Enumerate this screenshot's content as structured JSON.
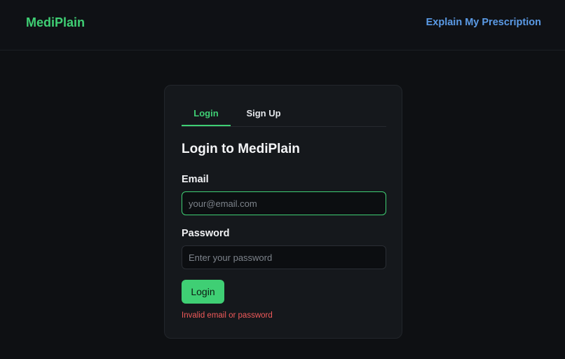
{
  "header": {
    "brand": "MediPlain",
    "nav_link": "Explain My Prescription"
  },
  "auth": {
    "tabs": [
      {
        "label": "Login",
        "active": true
      },
      {
        "label": "Sign Up",
        "active": false
      }
    ],
    "title": "Login to MediPlain",
    "email": {
      "label": "Email",
      "placeholder": "your@email.com",
      "value": ""
    },
    "password": {
      "label": "Password",
      "placeholder": "Enter your password",
      "value": ""
    },
    "submit_label": "Login",
    "error_message": "Invalid email or password"
  },
  "colors": {
    "accent": "#3fcf74",
    "link": "#5b9be6",
    "error": "#f05a5a",
    "background": "#0e1013",
    "card": "#15181c"
  }
}
